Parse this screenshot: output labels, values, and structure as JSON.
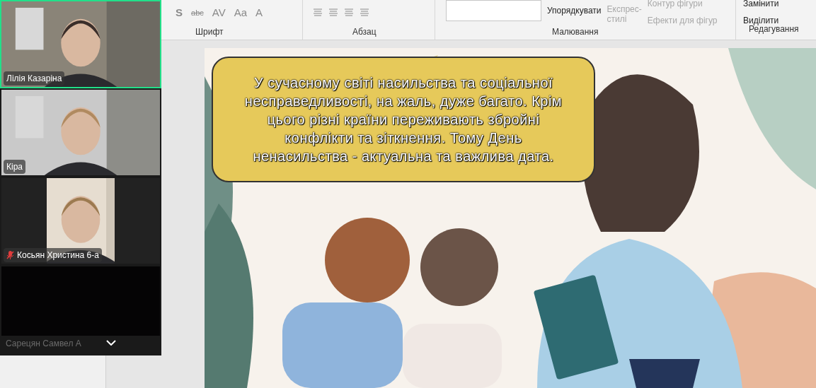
{
  "ribbon": {
    "font_buttons": [
      "S",
      "abc",
      "AV",
      "Aa",
      "A"
    ],
    "groups": [
      {
        "label": "Шрифт"
      },
      {
        "label": "Абзац"
      },
      {
        "label": "Малювання"
      },
      {
        "label": "Редагування"
      }
    ],
    "arrange": "Упорядкувати",
    "quick_styles": [
      "Експрес-",
      "стилі"
    ],
    "shape_outline": "Контур фігури",
    "shape_effects": "Ефекти для фігур",
    "replace": "Замінити",
    "select": "Виділити"
  },
  "slide": {
    "callout": "У сучасному світі насильства та соціальної несправедливості, на жаль, дуже багато. Крім цього різні країни переживають збройні конфлікти та зіткнення. Тому День ненасильства - актуальна та важлива дата."
  },
  "participants": [
    {
      "name": "Лілія Казаріна",
      "kind": "video",
      "active": true,
      "muted": false
    },
    {
      "name": "Кіра",
      "kind": "video",
      "active": false,
      "muted": false
    },
    {
      "name": "Косьян Христина 6-а",
      "kind": "narrow",
      "active": false,
      "muted": true
    },
    {
      "name": "Сарецян Самвел А",
      "kind": "dark",
      "active": false,
      "muted": false
    }
  ]
}
